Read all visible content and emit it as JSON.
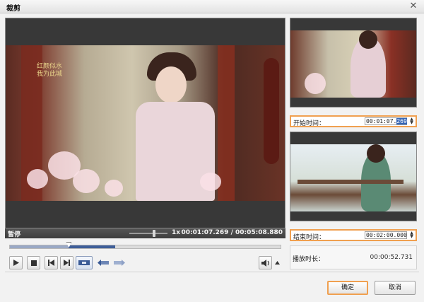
{
  "window": {
    "title": "裁剪",
    "close_glyph": "✕"
  },
  "player": {
    "status": "暂停",
    "speed": "1x",
    "current_time": "00:01:07.269",
    "separator": "/",
    "total_time": "00:05:08.880",
    "progress": 0.218,
    "selection_start": 0.218,
    "selection_end": 0.389,
    "calligraphy": "红颜似水 我为此城"
  },
  "controls": {
    "play_icon": "play-icon",
    "stop_icon": "stop-icon",
    "prev_icon": "skip-previous-icon",
    "next_icon": "skip-next-icon",
    "clip_icon": "clip-segment-icon",
    "set_start_icon": "set-start-icon",
    "set_end_icon": "set-end-icon",
    "volume_icon": "volume-icon",
    "volume_menu_icon": "chevron-up-icon"
  },
  "start": {
    "label": "开始时间：",
    "value_prefix": "00:01:07.",
    "value_selected": "269"
  },
  "end": {
    "label": "结束时间：",
    "value": "00:02:00.000"
  },
  "duration": {
    "label": "播放时长：",
    "value": "00:00:52.731"
  },
  "buttons": {
    "ok": "确定",
    "cancel": "取消"
  }
}
